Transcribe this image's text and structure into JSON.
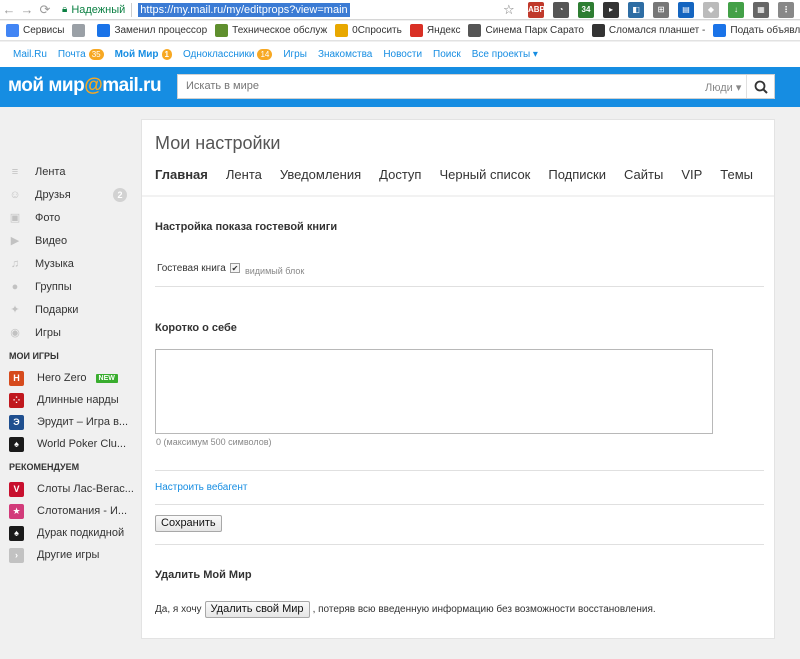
{
  "browser": {
    "secure_label": "Надежный",
    "url": "https://my.mail.ru/my/editprops?view=main"
  },
  "bookmarks": [
    {
      "label": "Сервисы",
      "color": "#4285f4"
    },
    {
      "label": "",
      "color": "#9aa0a6"
    },
    {
      "label": "Заменил процессор",
      "color": "#1a73e8"
    },
    {
      "label": "Техническое обслуж",
      "color": "#5f8f2e"
    },
    {
      "label": "0Спросить",
      "color": "#e8a800"
    },
    {
      "label": "Яндекс",
      "color": "#d93025"
    },
    {
      "label": "Синема Парк Сарато",
      "color": "#555"
    },
    {
      "label": "Сломался планшет -",
      "color": "#333"
    },
    {
      "label": "Подать объявление",
      "color": "#1a73e8"
    }
  ],
  "portal": {
    "links": [
      {
        "label": "Mail.Ru",
        "badge": "",
        "bold": false
      },
      {
        "label": "Почта",
        "badge": "35",
        "bold": false
      },
      {
        "label": "Мой Мир",
        "badge": "1",
        "bold": true
      },
      {
        "label": "Одноклассники",
        "badge": "14",
        "bold": false
      },
      {
        "label": "Игры",
        "badge": "",
        "bold": false
      },
      {
        "label": "Знакомства",
        "badge": "",
        "bold": false
      },
      {
        "label": "Новости",
        "badge": "",
        "bold": false
      },
      {
        "label": "Поиск",
        "badge": "",
        "bold": false
      },
      {
        "label": "Все проекты ▾",
        "badge": "",
        "bold": false
      }
    ]
  },
  "header": {
    "logo_main": "мой мир",
    "logo_at": "@",
    "logo_domain": "mail.ru",
    "search_placeholder": "Искать в мире",
    "search_scope": "Люди ▾"
  },
  "sidebar": {
    "nav": [
      {
        "label": "Лента",
        "icon": "feed-icon",
        "glyph": "≡",
        "count": ""
      },
      {
        "label": "Друзья",
        "icon": "friends-icon",
        "glyph": "☺",
        "count": "2"
      },
      {
        "label": "Фото",
        "icon": "photo-icon",
        "glyph": "▣",
        "count": ""
      },
      {
        "label": "Видео",
        "icon": "video-icon",
        "glyph": "▶",
        "count": ""
      },
      {
        "label": "Музыка",
        "icon": "music-icon",
        "glyph": "♫",
        "count": ""
      },
      {
        "label": "Группы",
        "icon": "groups-icon",
        "glyph": "●",
        "count": ""
      },
      {
        "label": "Подарки",
        "icon": "gifts-icon",
        "glyph": "✦",
        "count": ""
      },
      {
        "label": "Игры",
        "icon": "games-icon",
        "glyph": "◉",
        "count": ""
      }
    ],
    "my_games_heading": "МОИ ИГРЫ",
    "my_games": [
      {
        "label": "Hero Zero",
        "color": "#d64b1d",
        "glyph": "H",
        "badge": "NEW"
      },
      {
        "label": "Длинные нарды",
        "color": "#c0181e",
        "glyph": "⁘",
        "badge": ""
      },
      {
        "label": "Эрудит – Игра в...",
        "color": "#1f4f8f",
        "glyph": "Э",
        "badge": ""
      },
      {
        "label": "World Poker Clu...",
        "color": "#1a1a1a",
        "glyph": "♠",
        "badge": ""
      }
    ],
    "recommended_heading": "РЕКОМЕНДУЕМ",
    "recommended": [
      {
        "label": "Слоты Лас-Вегас...",
        "color": "#c8102e",
        "glyph": "V"
      },
      {
        "label": "Слотомания - И...",
        "color": "#d23b7a",
        "glyph": "★"
      },
      {
        "label": "Дурак подкидной",
        "color": "#1a1a1a",
        "glyph": "♠"
      },
      {
        "label": "Другие игры",
        "color": "#c2c2c2",
        "glyph": "›"
      }
    ]
  },
  "page": {
    "title": "Мои настройки",
    "tabs": [
      "Главная",
      "Лента",
      "Уведомления",
      "Доступ",
      "Черный список",
      "Подписки",
      "Сайты",
      "VIP",
      "Темы"
    ],
    "guestbook": {
      "heading": "Настройка показа гостевой книги",
      "label": "Гостевая книга",
      "checkbox_hint": "видимый блок",
      "checked": true
    },
    "about": {
      "heading": "Коротко о себе",
      "value": "",
      "counter": "0 (максимум 500 символов)"
    },
    "webagent_link": "Настроить вебагент",
    "save_button": "Сохранить",
    "delete": {
      "heading": "Удалить Мой Мир",
      "prefix": "Да, я хочу",
      "button": "Удалить свой Мир",
      "suffix": ", потеряв всю введенную информацию без возможности восстановления."
    }
  },
  "colors": {
    "brand_blue": "#168de2",
    "accent_orange": "#f7a823",
    "link_blue": "#168de2"
  }
}
